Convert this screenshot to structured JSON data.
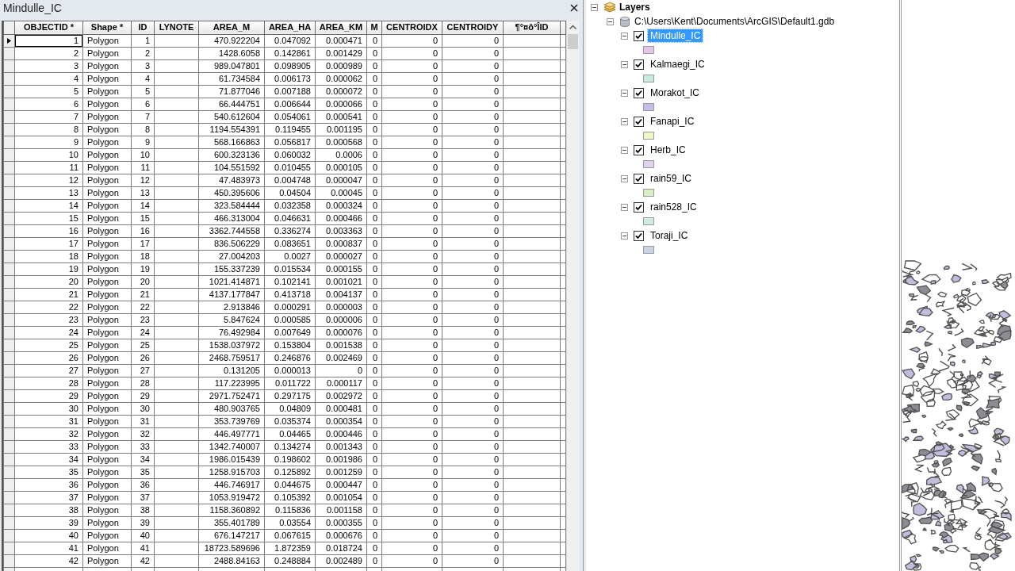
{
  "window": {
    "title": "Mindulle_IC"
  },
  "table": {
    "columns": [
      {
        "label": "OBJECTID *",
        "kind": "number"
      },
      {
        "label": "Shape *",
        "kind": "text"
      },
      {
        "label": "ID",
        "kind": "number"
      },
      {
        "label": "LYNOTE",
        "kind": "text"
      },
      {
        "label": "AREA_M",
        "kind": "number"
      },
      {
        "label": "AREA_HA",
        "kind": "number"
      },
      {
        "label": "AREA_KM",
        "kind": "number"
      },
      {
        "label": "M",
        "kind": "number"
      },
      {
        "label": "CENTROIDX",
        "kind": "number"
      },
      {
        "label": "CENTROIDY",
        "kind": "number"
      },
      {
        "label": "¶°¤ô°ÎID",
        "kind": "text"
      }
    ],
    "rows": [
      {
        "current": true,
        "cells": [
          "1",
          "Polygon",
          "1",
          null,
          "470.922204",
          "0.047092",
          "0.000471",
          "0",
          "0",
          "0",
          null
        ]
      },
      {
        "current": false,
        "cells": [
          "2",
          "Polygon",
          "2",
          null,
          "1428.6058",
          "0.142861",
          "0.001429",
          "0",
          "0",
          "0",
          null
        ]
      },
      {
        "current": false,
        "cells": [
          "3",
          "Polygon",
          "3",
          null,
          "989.047801",
          "0.098905",
          "0.000989",
          "0",
          "0",
          "0",
          null
        ]
      },
      {
        "current": false,
        "cells": [
          "4",
          "Polygon",
          "4",
          null,
          "61.734584",
          "0.006173",
          "0.000062",
          "0",
          "0",
          "0",
          null
        ]
      },
      {
        "current": false,
        "cells": [
          "5",
          "Polygon",
          "5",
          null,
          "71.877046",
          "0.007188",
          "0.000072",
          "0",
          "0",
          "0",
          null
        ]
      },
      {
        "current": false,
        "cells": [
          "6",
          "Polygon",
          "6",
          null,
          "66.444751",
          "0.006644",
          "0.000066",
          "0",
          "0",
          "0",
          null
        ]
      },
      {
        "current": false,
        "cells": [
          "7",
          "Polygon",
          "7",
          null,
          "540.612604",
          "0.054061",
          "0.000541",
          "0",
          "0",
          "0",
          null
        ]
      },
      {
        "current": false,
        "cells": [
          "8",
          "Polygon",
          "8",
          null,
          "1194.554391",
          "0.119455",
          "0.001195",
          "0",
          "0",
          "0",
          null
        ]
      },
      {
        "current": false,
        "cells": [
          "9",
          "Polygon",
          "9",
          null,
          "568.166863",
          "0.056817",
          "0.000568",
          "0",
          "0",
          "0",
          null
        ]
      },
      {
        "current": false,
        "cells": [
          "10",
          "Polygon",
          "10",
          null,
          "600.323136",
          "0.060032",
          "0.0006",
          "0",
          "0",
          "0",
          null
        ]
      },
      {
        "current": false,
        "cells": [
          "11",
          "Polygon",
          "11",
          null,
          "104.551592",
          "0.010455",
          "0.000105",
          "0",
          "0",
          "0",
          null
        ]
      },
      {
        "current": false,
        "cells": [
          "12",
          "Polygon",
          "12",
          null,
          "47.483973",
          "0.004748",
          "0.000047",
          "0",
          "0",
          "0",
          null
        ]
      },
      {
        "current": false,
        "cells": [
          "13",
          "Polygon",
          "13",
          null,
          "450.395606",
          "0.04504",
          "0.00045",
          "0",
          "0",
          "0",
          null
        ]
      },
      {
        "current": false,
        "cells": [
          "14",
          "Polygon",
          "14",
          null,
          "323.584444",
          "0.032358",
          "0.000324",
          "0",
          "0",
          "0",
          null
        ]
      },
      {
        "current": false,
        "cells": [
          "15",
          "Polygon",
          "15",
          null,
          "466.313004",
          "0.046631",
          "0.000466",
          "0",
          "0",
          "0",
          null
        ]
      },
      {
        "current": false,
        "cells": [
          "16",
          "Polygon",
          "16",
          null,
          "3362.744558",
          "0.336274",
          "0.003363",
          "0",
          "0",
          "0",
          null
        ]
      },
      {
        "current": false,
        "cells": [
          "17",
          "Polygon",
          "17",
          null,
          "836.506229",
          "0.083651",
          "0.000837",
          "0",
          "0",
          "0",
          null
        ]
      },
      {
        "current": false,
        "cells": [
          "18",
          "Polygon",
          "18",
          null,
          "27.004203",
          "0.0027",
          "0.000027",
          "0",
          "0",
          "0",
          null
        ]
      },
      {
        "current": false,
        "cells": [
          "19",
          "Polygon",
          "19",
          null,
          "155.337239",
          "0.015534",
          "0.000155",
          "0",
          "0",
          "0",
          null
        ]
      },
      {
        "current": false,
        "cells": [
          "20",
          "Polygon",
          "20",
          null,
          "1021.414871",
          "0.102141",
          "0.001021",
          "0",
          "0",
          "0",
          null
        ]
      },
      {
        "current": false,
        "cells": [
          "21",
          "Polygon",
          "21",
          null,
          "4137.177847",
          "0.413718",
          "0.004137",
          "0",
          "0",
          "0",
          null
        ]
      },
      {
        "current": false,
        "cells": [
          "22",
          "Polygon",
          "22",
          null,
          "2.913846",
          "0.000291",
          "0.000003",
          "0",
          "0",
          "0",
          null
        ]
      },
      {
        "current": false,
        "cells": [
          "23",
          "Polygon",
          "23",
          null,
          "5.847624",
          "0.000585",
          "0.000006",
          "0",
          "0",
          "0",
          null
        ]
      },
      {
        "current": false,
        "cells": [
          "24",
          "Polygon",
          "24",
          null,
          "76.492984",
          "0.007649",
          "0.000076",
          "0",
          "0",
          "0",
          null
        ]
      },
      {
        "current": false,
        "cells": [
          "25",
          "Polygon",
          "25",
          null,
          "1538.037972",
          "0.153804",
          "0.001538",
          "0",
          "0",
          "0",
          null
        ]
      },
      {
        "current": false,
        "cells": [
          "26",
          "Polygon",
          "26",
          null,
          "2468.759517",
          "0.246876",
          "0.002469",
          "0",
          "0",
          "0",
          null
        ]
      },
      {
        "current": false,
        "cells": [
          "27",
          "Polygon",
          "27",
          null,
          "0.131205",
          "0.000013",
          "0",
          "0",
          "0",
          "0",
          null
        ]
      },
      {
        "current": false,
        "cells": [
          "28",
          "Polygon",
          "28",
          null,
          "117.223995",
          "0.011722",
          "0.000117",
          "0",
          "0",
          "0",
          null
        ]
      },
      {
        "current": false,
        "cells": [
          "29",
          "Polygon",
          "29",
          null,
          "2971.752471",
          "0.297175",
          "0.002972",
          "0",
          "0",
          "0",
          null
        ]
      },
      {
        "current": false,
        "cells": [
          "30",
          "Polygon",
          "30",
          null,
          "480.903765",
          "0.04809",
          "0.000481",
          "0",
          "0",
          "0",
          null
        ]
      },
      {
        "current": false,
        "cells": [
          "31",
          "Polygon",
          "31",
          null,
          "353.739769",
          "0.035374",
          "0.000354",
          "0",
          "0",
          "0",
          null
        ]
      },
      {
        "current": false,
        "cells": [
          "32",
          "Polygon",
          "32",
          null,
          "446.497771",
          "0.04465",
          "0.000446",
          "0",
          "0",
          "0",
          null
        ]
      },
      {
        "current": false,
        "cells": [
          "33",
          "Polygon",
          "33",
          null,
          "1342.740007",
          "0.134274",
          "0.001343",
          "0",
          "0",
          "0",
          null
        ]
      },
      {
        "current": false,
        "cells": [
          "34",
          "Polygon",
          "34",
          null,
          "1986.015439",
          "0.198602",
          "0.001986",
          "0",
          "0",
          "0",
          null
        ]
      },
      {
        "current": false,
        "cells": [
          "35",
          "Polygon",
          "35",
          null,
          "1258.915703",
          "0.125892",
          "0.001259",
          "0",
          "0",
          "0",
          null
        ]
      },
      {
        "current": false,
        "cells": [
          "36",
          "Polygon",
          "36",
          null,
          "446.746917",
          "0.044675",
          "0.000447",
          "0",
          "0",
          "0",
          null
        ]
      },
      {
        "current": false,
        "cells": [
          "37",
          "Polygon",
          "37",
          null,
          "1053.919472",
          "0.105392",
          "0.001054",
          "0",
          "0",
          "0",
          null
        ]
      },
      {
        "current": false,
        "cells": [
          "38",
          "Polygon",
          "38",
          null,
          "1158.360892",
          "0.115836",
          "0.001158",
          "0",
          "0",
          "0",
          null
        ]
      },
      {
        "current": false,
        "cells": [
          "39",
          "Polygon",
          "39",
          null,
          "355.401789",
          "0.03554",
          "0.000355",
          "0",
          "0",
          "0",
          null
        ]
      },
      {
        "current": false,
        "cells": [
          "40",
          "Polygon",
          "40",
          null,
          "676.147217",
          "0.067615",
          "0.000676",
          "0",
          "0",
          "0",
          null
        ]
      },
      {
        "current": false,
        "cells": [
          "41",
          "Polygon",
          "41",
          null,
          "18723.589696",
          "1.872359",
          "0.018724",
          "0",
          "0",
          "0",
          null
        ]
      },
      {
        "current": false,
        "cells": [
          "42",
          "Polygon",
          "42",
          null,
          "2488.84163",
          "0.248884",
          "0.002489",
          "0",
          "0",
          "0",
          null
        ]
      }
    ]
  },
  "table_of_contents": {
    "label": "Layers",
    "expanded": true,
    "children": [
      {
        "label": "C:\\Users\\Kent\\Documents\\ArcGIS\\Default1.gdb",
        "expanded": true,
        "children": [
          {
            "label": "Mindulle_IC",
            "expanded": true,
            "checked": true,
            "selected": true,
            "color": "#e6c3eb"
          },
          {
            "label": "Kalmaegi_IC",
            "expanded": true,
            "checked": true,
            "selected": false,
            "color": "#c8ebdc"
          },
          {
            "label": "Morakot_IC",
            "expanded": true,
            "checked": true,
            "selected": false,
            "color": "#c3bee6"
          },
          {
            "label": "Fanapi_IC",
            "expanded": true,
            "checked": true,
            "selected": false,
            "color": "#f0f5c8"
          },
          {
            "label": "Herb_IC",
            "expanded": true,
            "checked": true,
            "selected": false,
            "color": "#e1d2eb"
          },
          {
            "label": "rain59_IC",
            "expanded": true,
            "checked": true,
            "selected": false,
            "color": "#d7f0c3"
          },
          {
            "label": "rain528_IC",
            "expanded": true,
            "checked": true,
            "selected": false,
            "color": "#d2ebe1"
          },
          {
            "label": "Toraji_IC",
            "expanded": true,
            "checked": true,
            "selected": false,
            "color": "#c8d4e6"
          }
        ]
      }
    ]
  }
}
